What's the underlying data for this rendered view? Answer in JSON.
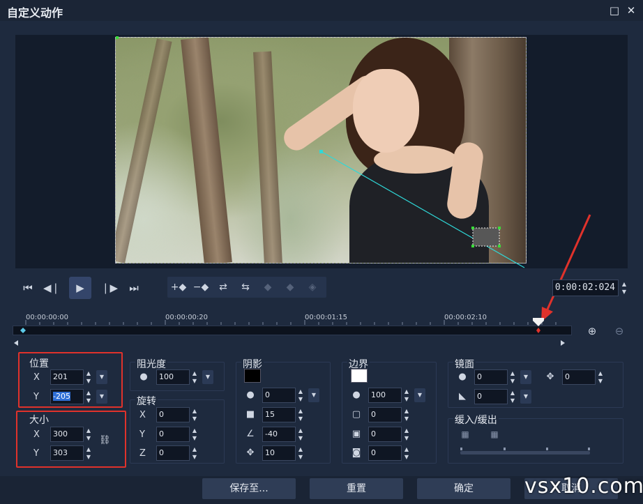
{
  "window": {
    "title": "自定义动作",
    "maximize_icon": "maximize-icon",
    "close_icon": "close-icon"
  },
  "transport": {
    "timecode": "0:00:02:024"
  },
  "timeline": {
    "ticks": [
      "00:00:00:00",
      "00:00:00:20",
      "00:00:01:15",
      "00:00:02:10"
    ]
  },
  "position": {
    "title": "位置",
    "x_label": "X",
    "x_value": "201",
    "y_label": "Y",
    "y_value": "-205"
  },
  "size": {
    "title": "大小",
    "x_label": "X",
    "x_value": "300",
    "y_label": "Y",
    "y_value": "303"
  },
  "opacity": {
    "title": "阻光度",
    "value": "100"
  },
  "rotation": {
    "title": "旋转",
    "x_label": "X",
    "x_value": "0",
    "y_label": "Y",
    "y_value": "0",
    "z_label": "Z",
    "z_value": "0"
  },
  "shadow": {
    "title": "阴影",
    "color": "#000000",
    "opacity": "0",
    "blur": "15",
    "angle": "-40",
    "distance": "10"
  },
  "border": {
    "title": "边界",
    "color": "#ffffff",
    "opacity": "100",
    "width": "0",
    "blur": "0",
    "corner": "0"
  },
  "mirror": {
    "title": "镜面",
    "opacity": "0",
    "offset": "0",
    "fade": "0"
  },
  "ease": {
    "title": "缓入/缓出"
  },
  "footer": {
    "save_to": "保存至...",
    "reset": "重置",
    "ok": "确定",
    "cancel": "取消"
  },
  "watermark": "vsx10.com"
}
